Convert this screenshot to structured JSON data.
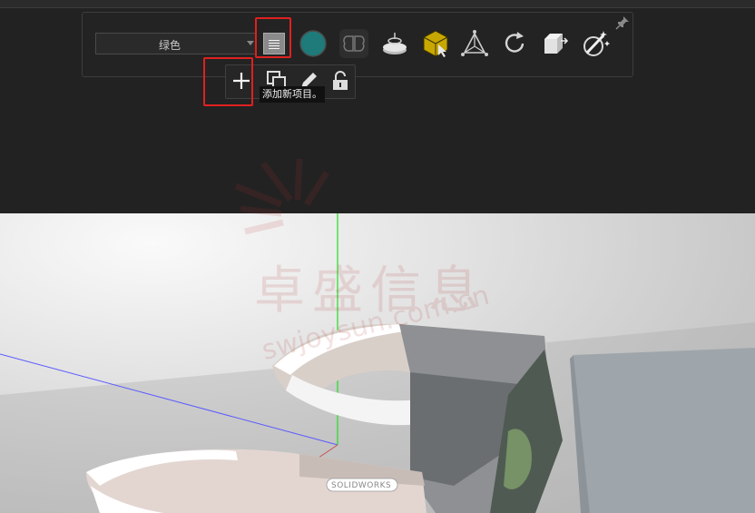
{
  "toolbar": {
    "color_select_value": "绿色",
    "icons": [
      "list-icon",
      "sphere-icon",
      "brain-icon",
      "turntable-icon",
      "select-box-icon",
      "transform-icon",
      "refresh-icon",
      "cube-export-icon",
      "magic-render-icon"
    ],
    "sphere_color": "#1f7a7a",
    "box_color": "#c8a800"
  },
  "subbar": {
    "icons": [
      "plus-icon",
      "copy-icon",
      "edit-icon",
      "lock-icon"
    ],
    "tooltip": "添加新项目。"
  },
  "viewport": {
    "product_label": "SOLIDWORKS"
  },
  "watermark": {
    "brand_cn": "卓盛信息",
    "url": "swjoysun.com.cn"
  },
  "colors": {
    "highlight": "#e02020"
  }
}
